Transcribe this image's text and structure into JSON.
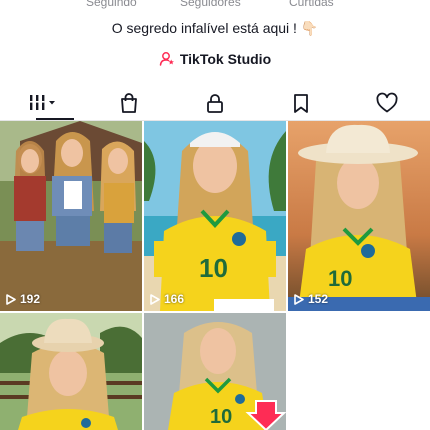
{
  "profile": {
    "following_label": "Seguindo",
    "followers_label": "Seguidores",
    "likes_label": "Curtidas",
    "bio": "O segredo infalível está aqui ! 👇🏻",
    "studio_label": "TikTok Studio"
  },
  "tabs": [
    {
      "name": "videos",
      "icon": "grid-icon",
      "active": true
    },
    {
      "name": "shop",
      "icon": "shopping-bag-icon",
      "active": false
    },
    {
      "name": "private",
      "icon": "lock-icon",
      "active": false
    },
    {
      "name": "saved",
      "icon": "bookmark-icon",
      "active": false
    },
    {
      "name": "liked",
      "icon": "heart-icon",
      "active": false
    }
  ],
  "videos": [
    {
      "views": "192",
      "description": "three women in denim country outfits"
    },
    {
      "views": "166",
      "description": "woman in Brazil jersey on beach"
    },
    {
      "views": "152",
      "description": "woman in cowboy hat and Brazil jersey at sunset"
    },
    {
      "views": "",
      "description": "woman in cowboy hat and Brazil jersey on farm"
    },
    {
      "views": "",
      "description": "woman in Brazil jersey, grey backdrop"
    }
  ],
  "colors": {
    "text": "#161823",
    "muted": "#8a8b91",
    "accent": "#fe2c55",
    "jersey_yellow": "#f5d31c",
    "jersey_green": "#1f9a3f"
  }
}
